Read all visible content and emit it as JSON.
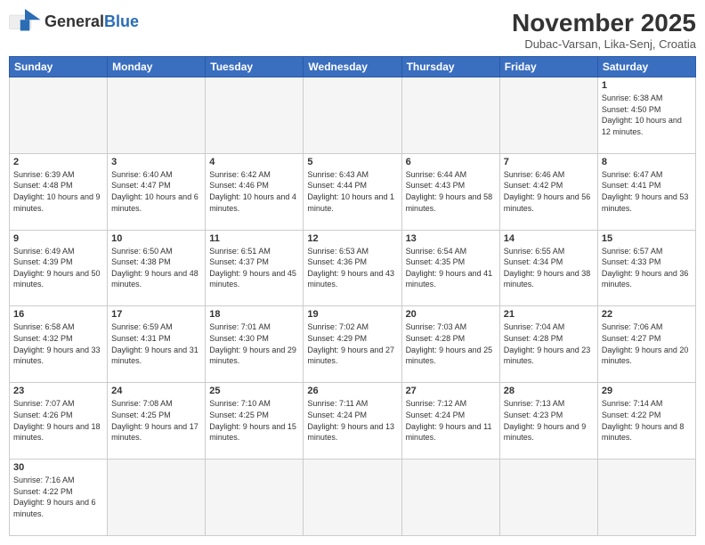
{
  "logo": {
    "text_general": "General",
    "text_blue": "Blue"
  },
  "header": {
    "month": "November 2025",
    "location": "Dubac-Varsan, Lika-Senj, Croatia"
  },
  "days_of_week": [
    "Sunday",
    "Monday",
    "Tuesday",
    "Wednesday",
    "Thursday",
    "Friday",
    "Saturday"
  ],
  "weeks": [
    [
      {
        "day": "",
        "empty": true
      },
      {
        "day": "",
        "empty": true
      },
      {
        "day": "",
        "empty": true
      },
      {
        "day": "",
        "empty": true
      },
      {
        "day": "",
        "empty": true
      },
      {
        "day": "",
        "empty": true
      },
      {
        "day": "1",
        "sunrise": "6:38 AM",
        "sunset": "4:50 PM",
        "daylight": "10 hours and 12 minutes."
      }
    ],
    [
      {
        "day": "2",
        "sunrise": "6:39 AM",
        "sunset": "4:48 PM",
        "daylight": "10 hours and 9 minutes."
      },
      {
        "day": "3",
        "sunrise": "6:40 AM",
        "sunset": "4:47 PM",
        "daylight": "10 hours and 6 minutes."
      },
      {
        "day": "4",
        "sunrise": "6:42 AM",
        "sunset": "4:46 PM",
        "daylight": "10 hours and 4 minutes."
      },
      {
        "day": "5",
        "sunrise": "6:43 AM",
        "sunset": "4:44 PM",
        "daylight": "10 hours and 1 minute."
      },
      {
        "day": "6",
        "sunrise": "6:44 AM",
        "sunset": "4:43 PM",
        "daylight": "9 hours and 58 minutes."
      },
      {
        "day": "7",
        "sunrise": "6:46 AM",
        "sunset": "4:42 PM",
        "daylight": "9 hours and 56 minutes."
      },
      {
        "day": "8",
        "sunrise": "6:47 AM",
        "sunset": "4:41 PM",
        "daylight": "9 hours and 53 minutes."
      }
    ],
    [
      {
        "day": "9",
        "sunrise": "6:49 AM",
        "sunset": "4:39 PM",
        "daylight": "9 hours and 50 minutes."
      },
      {
        "day": "10",
        "sunrise": "6:50 AM",
        "sunset": "4:38 PM",
        "daylight": "9 hours and 48 minutes."
      },
      {
        "day": "11",
        "sunrise": "6:51 AM",
        "sunset": "4:37 PM",
        "daylight": "9 hours and 45 minutes."
      },
      {
        "day": "12",
        "sunrise": "6:53 AM",
        "sunset": "4:36 PM",
        "daylight": "9 hours and 43 minutes."
      },
      {
        "day": "13",
        "sunrise": "6:54 AM",
        "sunset": "4:35 PM",
        "daylight": "9 hours and 41 minutes."
      },
      {
        "day": "14",
        "sunrise": "6:55 AM",
        "sunset": "4:34 PM",
        "daylight": "9 hours and 38 minutes."
      },
      {
        "day": "15",
        "sunrise": "6:57 AM",
        "sunset": "4:33 PM",
        "daylight": "9 hours and 36 minutes."
      }
    ],
    [
      {
        "day": "16",
        "sunrise": "6:58 AM",
        "sunset": "4:32 PM",
        "daylight": "9 hours and 33 minutes."
      },
      {
        "day": "17",
        "sunrise": "6:59 AM",
        "sunset": "4:31 PM",
        "daylight": "9 hours and 31 minutes."
      },
      {
        "day": "18",
        "sunrise": "7:01 AM",
        "sunset": "4:30 PM",
        "daylight": "9 hours and 29 minutes."
      },
      {
        "day": "19",
        "sunrise": "7:02 AM",
        "sunset": "4:29 PM",
        "daylight": "9 hours and 27 minutes."
      },
      {
        "day": "20",
        "sunrise": "7:03 AM",
        "sunset": "4:28 PM",
        "daylight": "9 hours and 25 minutes."
      },
      {
        "day": "21",
        "sunrise": "7:04 AM",
        "sunset": "4:28 PM",
        "daylight": "9 hours and 23 minutes."
      },
      {
        "day": "22",
        "sunrise": "7:06 AM",
        "sunset": "4:27 PM",
        "daylight": "9 hours and 20 minutes."
      }
    ],
    [
      {
        "day": "23",
        "sunrise": "7:07 AM",
        "sunset": "4:26 PM",
        "daylight": "9 hours and 18 minutes."
      },
      {
        "day": "24",
        "sunrise": "7:08 AM",
        "sunset": "4:25 PM",
        "daylight": "9 hours and 17 minutes."
      },
      {
        "day": "25",
        "sunrise": "7:10 AM",
        "sunset": "4:25 PM",
        "daylight": "9 hours and 15 minutes."
      },
      {
        "day": "26",
        "sunrise": "7:11 AM",
        "sunset": "4:24 PM",
        "daylight": "9 hours and 13 minutes."
      },
      {
        "day": "27",
        "sunrise": "7:12 AM",
        "sunset": "4:24 PM",
        "daylight": "9 hours and 11 minutes."
      },
      {
        "day": "28",
        "sunrise": "7:13 AM",
        "sunset": "4:23 PM",
        "daylight": "9 hours and 9 minutes."
      },
      {
        "day": "29",
        "sunrise": "7:14 AM",
        "sunset": "4:22 PM",
        "daylight": "9 hours and 8 minutes."
      }
    ],
    [
      {
        "day": "30",
        "sunrise": "7:16 AM",
        "sunset": "4:22 PM",
        "daylight": "9 hours and 6 minutes."
      },
      {
        "day": "",
        "empty": true
      },
      {
        "day": "",
        "empty": true
      },
      {
        "day": "",
        "empty": true
      },
      {
        "day": "",
        "empty": true
      },
      {
        "day": "",
        "empty": true
      },
      {
        "day": "",
        "empty": true
      }
    ]
  ]
}
